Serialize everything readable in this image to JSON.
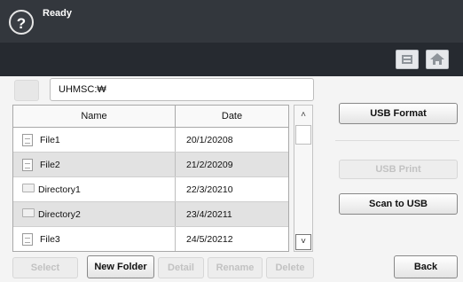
{
  "header": {
    "help_icon": "?",
    "status": "Ready"
  },
  "toolbar": {
    "icons": [
      "settings-icon",
      "home-icon"
    ]
  },
  "path": {
    "value": "UHMSC:₩"
  },
  "table": {
    "columns": [
      "Name",
      "Date"
    ],
    "rows": [
      {
        "type": "file",
        "name": "File1",
        "date": "20/1/20208"
      },
      {
        "type": "file",
        "name": "File2",
        "date": "21/2/20209"
      },
      {
        "type": "directory",
        "name": "Directory1",
        "date": "22/3/20210"
      },
      {
        "type": "directory",
        "name": "Directory2",
        "date": "23/4/20211"
      },
      {
        "type": "file",
        "name": "File3",
        "date": "24/5/20212"
      }
    ]
  },
  "scroll": {
    "up": "˄",
    "down": "˅"
  },
  "bottom_buttons": {
    "select": "Select",
    "new_folder": "New Folder",
    "detail": "Detail",
    "rename": "Rename",
    "delete": "Delete"
  },
  "side_buttons": {
    "usb_format": "USB Format",
    "usb_print": "USB Print",
    "scan_to_usb": "Scan to USB",
    "back": "Back"
  }
}
